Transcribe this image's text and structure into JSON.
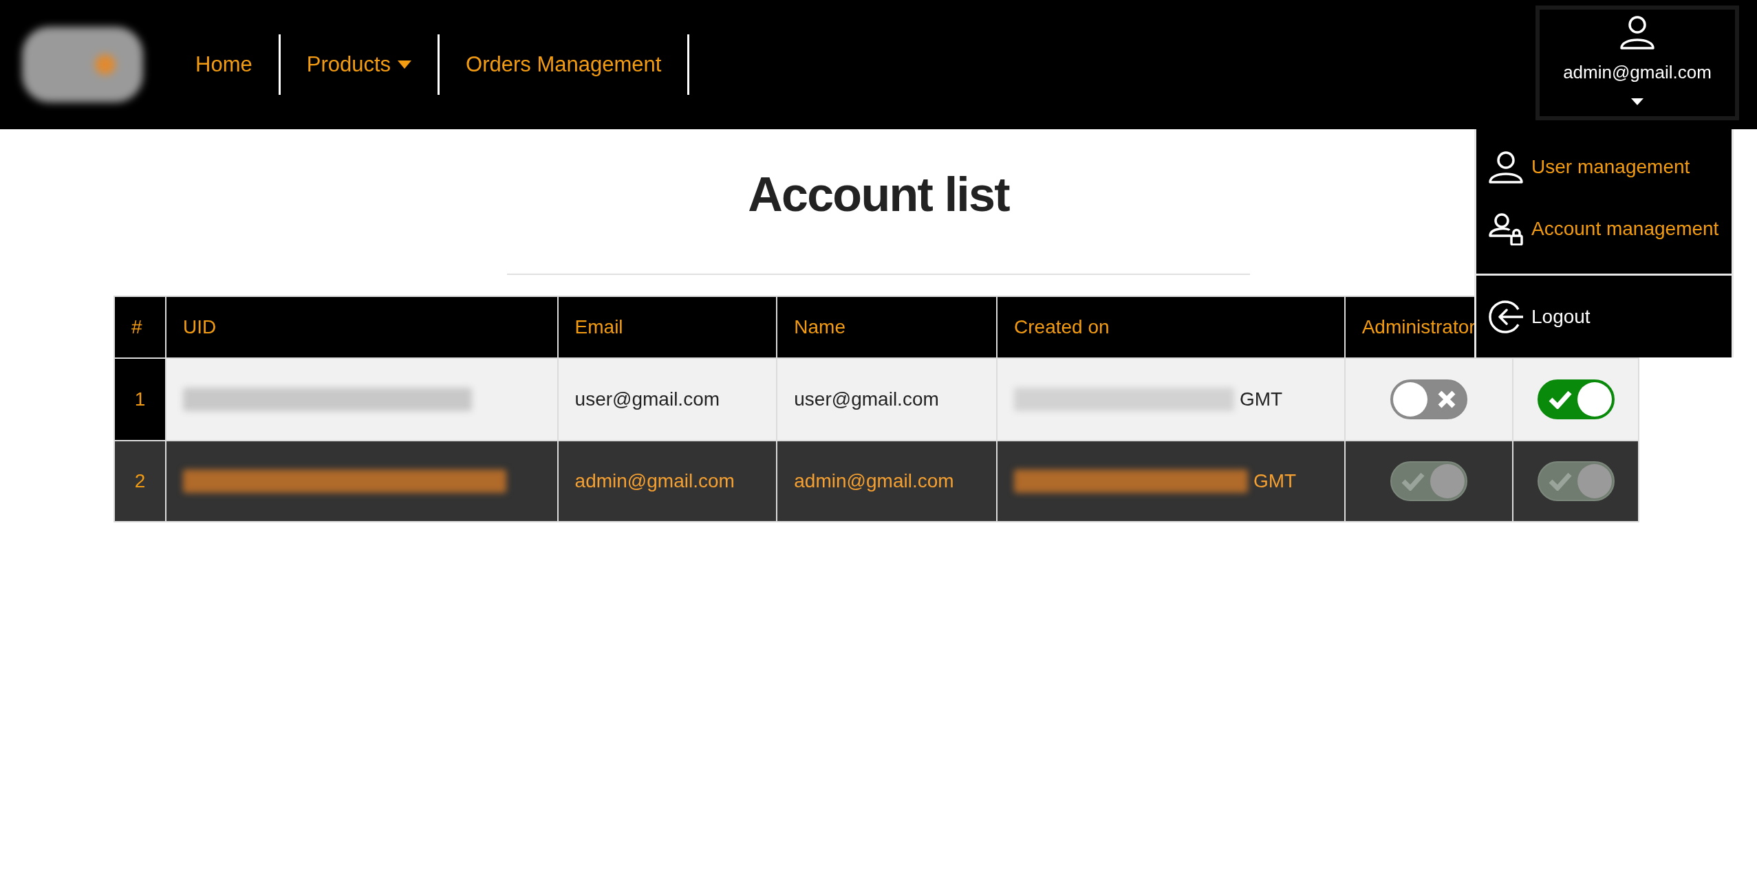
{
  "nav": {
    "items": [
      {
        "label": "Home",
        "dropdown": false
      },
      {
        "label": "Products",
        "dropdown": true
      },
      {
        "label": "Orders Management",
        "dropdown": false
      }
    ]
  },
  "user_menu": {
    "email": "admin@gmail.com",
    "expanded": true,
    "items": [
      {
        "kind": "user",
        "label": "User management"
      },
      {
        "kind": "account",
        "label": "Account management"
      },
      {
        "kind": "logout",
        "label": "Logout"
      }
    ]
  },
  "page": {
    "title": "Account list"
  },
  "table": {
    "columns": [
      "#",
      "UID",
      "Email",
      "Name",
      "Created on",
      "Administrator"
    ],
    "rows": [
      {
        "index": "1",
        "email": "user@gmail.com",
        "name": "user@gmail.com",
        "created_on": "GMT",
        "highlighted": false,
        "administrator": {
          "on": false,
          "disabled": false
        },
        "column_7": {
          "on": true,
          "disabled": false
        }
      },
      {
        "index": "2",
        "email": "admin@gmail.com",
        "name": "admin@gmail.com",
        "created_on": "GMT",
        "highlighted": true,
        "administrator": {
          "on": true,
          "disabled": true
        },
        "column_7": {
          "on": true,
          "disabled": true
        }
      }
    ]
  }
}
